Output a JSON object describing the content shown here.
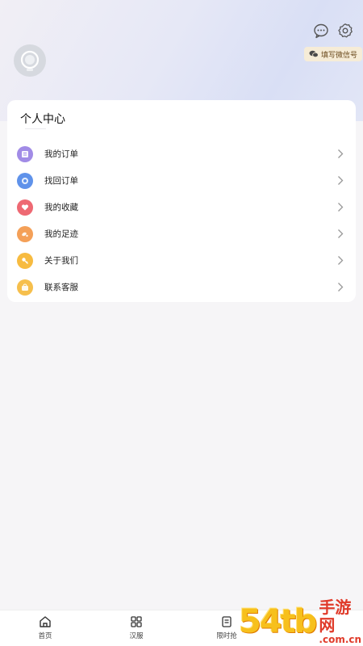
{
  "header": {
    "message_icon": "message-bubble-icon",
    "settings_icon": "gear-icon",
    "wechat_tag_label": "填写微信号",
    "avatar_icon": "default-avatar-icon"
  },
  "card": {
    "title": "个人中心",
    "items": [
      {
        "label": "我的订单",
        "icon": "order-icon",
        "color": "#9b7fe0"
      },
      {
        "label": "找回订单",
        "icon": "retrieve-order-icon",
        "color": "#5b8fe8"
      },
      {
        "label": "我的收藏",
        "icon": "heart-icon",
        "color": "#ec6670"
      },
      {
        "label": "我的足迹",
        "icon": "footprint-icon",
        "color": "#f49c4e"
      },
      {
        "label": "关于我们",
        "icon": "key-icon",
        "color": "#f6b73a"
      },
      {
        "label": "联系客服",
        "icon": "service-icon",
        "color": "#f5b941"
      }
    ]
  },
  "tabbar": {
    "tabs": [
      {
        "label": "首页",
        "icon": "home-icon"
      },
      {
        "label": "汉服",
        "icon": "grid-icon"
      },
      {
        "label": "限时抢",
        "icon": "document-icon"
      }
    ]
  },
  "watermark": {
    "big": "54tb",
    "cn": "手游网",
    "com": ".com.cn"
  }
}
